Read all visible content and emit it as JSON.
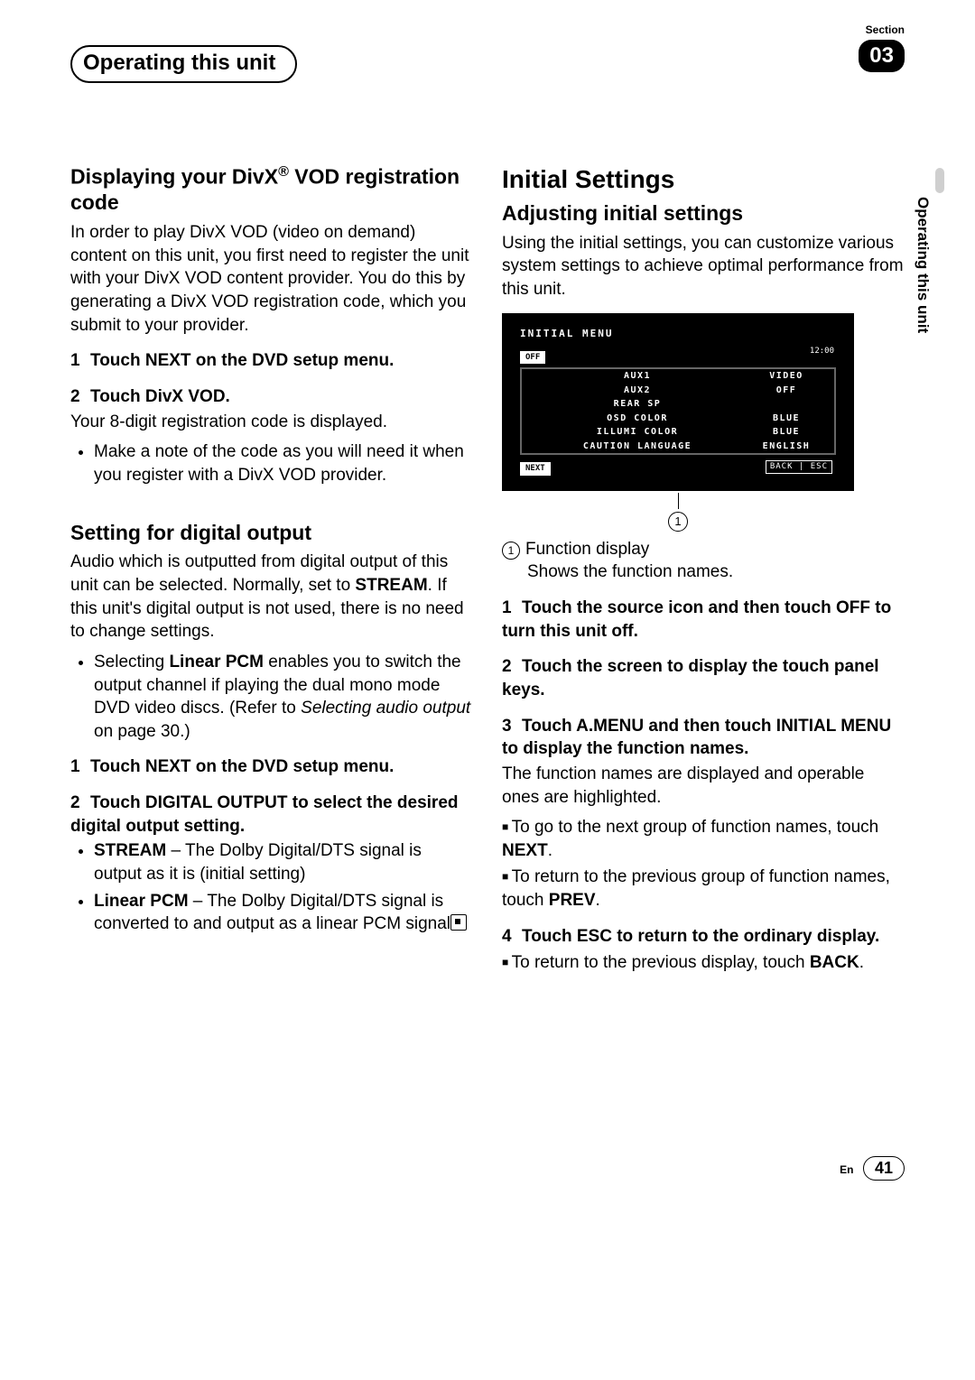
{
  "header": {
    "title": "Operating this unit",
    "section_label": "Section",
    "section_number": "03",
    "vertical_tab": "Operating this unit"
  },
  "left": {
    "h_divx_a": "Displaying your DivX",
    "h_divx_sup": "®",
    "h_divx_b": " VOD registration code",
    "divx_p": "In order to play DivX VOD (video on demand) content on this unit, you first need to register the unit with your DivX VOD content provider. You do this by generating a DivX VOD registration code, which you submit to your provider.",
    "divx_s1_num": "1",
    "divx_s1": "Touch NEXT on the DVD setup menu.",
    "divx_s2_num": "2",
    "divx_s2": "Touch DivX VOD.",
    "divx_after": "Your 8-digit registration code is displayed.",
    "divx_bul": "Make a note of the code as you will need it when you register with a DivX VOD provider.",
    "h_digital": "Setting for digital output",
    "dig_p_a": "Audio which is outputted from digital output of this unit can be selected. Normally, set to ",
    "dig_p_strong": "STREAM",
    "dig_p_b": ". If this unit's digital output is not used, there is no need to change settings.",
    "dig_bul_a": "Selecting ",
    "dig_bul_strong": "Linear PCM",
    "dig_bul_b": " enables you to switch the output channel if playing the dual mono mode DVD video discs. (Refer to ",
    "dig_bul_em": "Selecting audio output",
    "dig_bul_c": " on page 30.)",
    "dig_s1_num": "1",
    "dig_s1": "Touch NEXT on the DVD setup menu.",
    "dig_s2_num": "2",
    "dig_s2": "Touch DIGITAL OUTPUT to select the desired digital output setting.",
    "dig_stream_s": "STREAM",
    "dig_stream_t": " – The Dolby Digital/DTS signal is output as it is (initial setting)",
    "dig_pcm_s": "Linear PCM",
    "dig_pcm_t": " – The Dolby Digital/DTS signal is converted to and output as a linear PCM signal"
  },
  "right": {
    "h_initial": "Initial Settings",
    "h_adjust": "Adjusting initial settings",
    "adj_p": "Using the initial settings, you can customize various system settings to achieve optimal performance from this unit.",
    "legend_num": "1",
    "legend_label": "Function display",
    "legend_sub": "Shows the function names.",
    "s1_num": "1",
    "s1": "Touch the source icon and then touch OFF to turn this unit off.",
    "s2_num": "2",
    "s2": "Touch the screen to display the touch panel keys.",
    "s3_num": "3",
    "s3": "Touch A.MENU and then touch INITIAL MENU to display the function names.",
    "s3_after": "The function names are displayed and operable ones are highlighted.",
    "sq1_a": "To go to the next group of function names, touch ",
    "sq1_b": "NEXT",
    "sq1_c": ".",
    "sq2_a": "To return to the previous group of function names, touch ",
    "sq2_b": "PREV",
    "sq2_c": ".",
    "s4_num": "4",
    "s4": "Touch ESC to return to the ordinary display.",
    "sq3_a": "To return to the previous display, touch ",
    "sq3_b": "BACK",
    "sq3_c": "."
  },
  "screen": {
    "title": "INITIAL MENU",
    "off": "OFF",
    "time": "12:00",
    "rows": [
      {
        "l": "AUX1",
        "r": "VIDEO"
      },
      {
        "l": "AUX2",
        "r": "OFF"
      },
      {
        "l": "REAR SP",
        "r": ""
      },
      {
        "l": "OSD COLOR",
        "r": "BLUE"
      },
      {
        "l": "ILLUMI COLOR",
        "r": "BLUE"
      },
      {
        "l": "CAUTION LANGUAGE",
        "r": "ENGLISH"
      }
    ],
    "next": "NEXT",
    "backesc": "BACK | ESC",
    "callout": "1"
  },
  "footer": {
    "lang": "En",
    "page": "41"
  }
}
